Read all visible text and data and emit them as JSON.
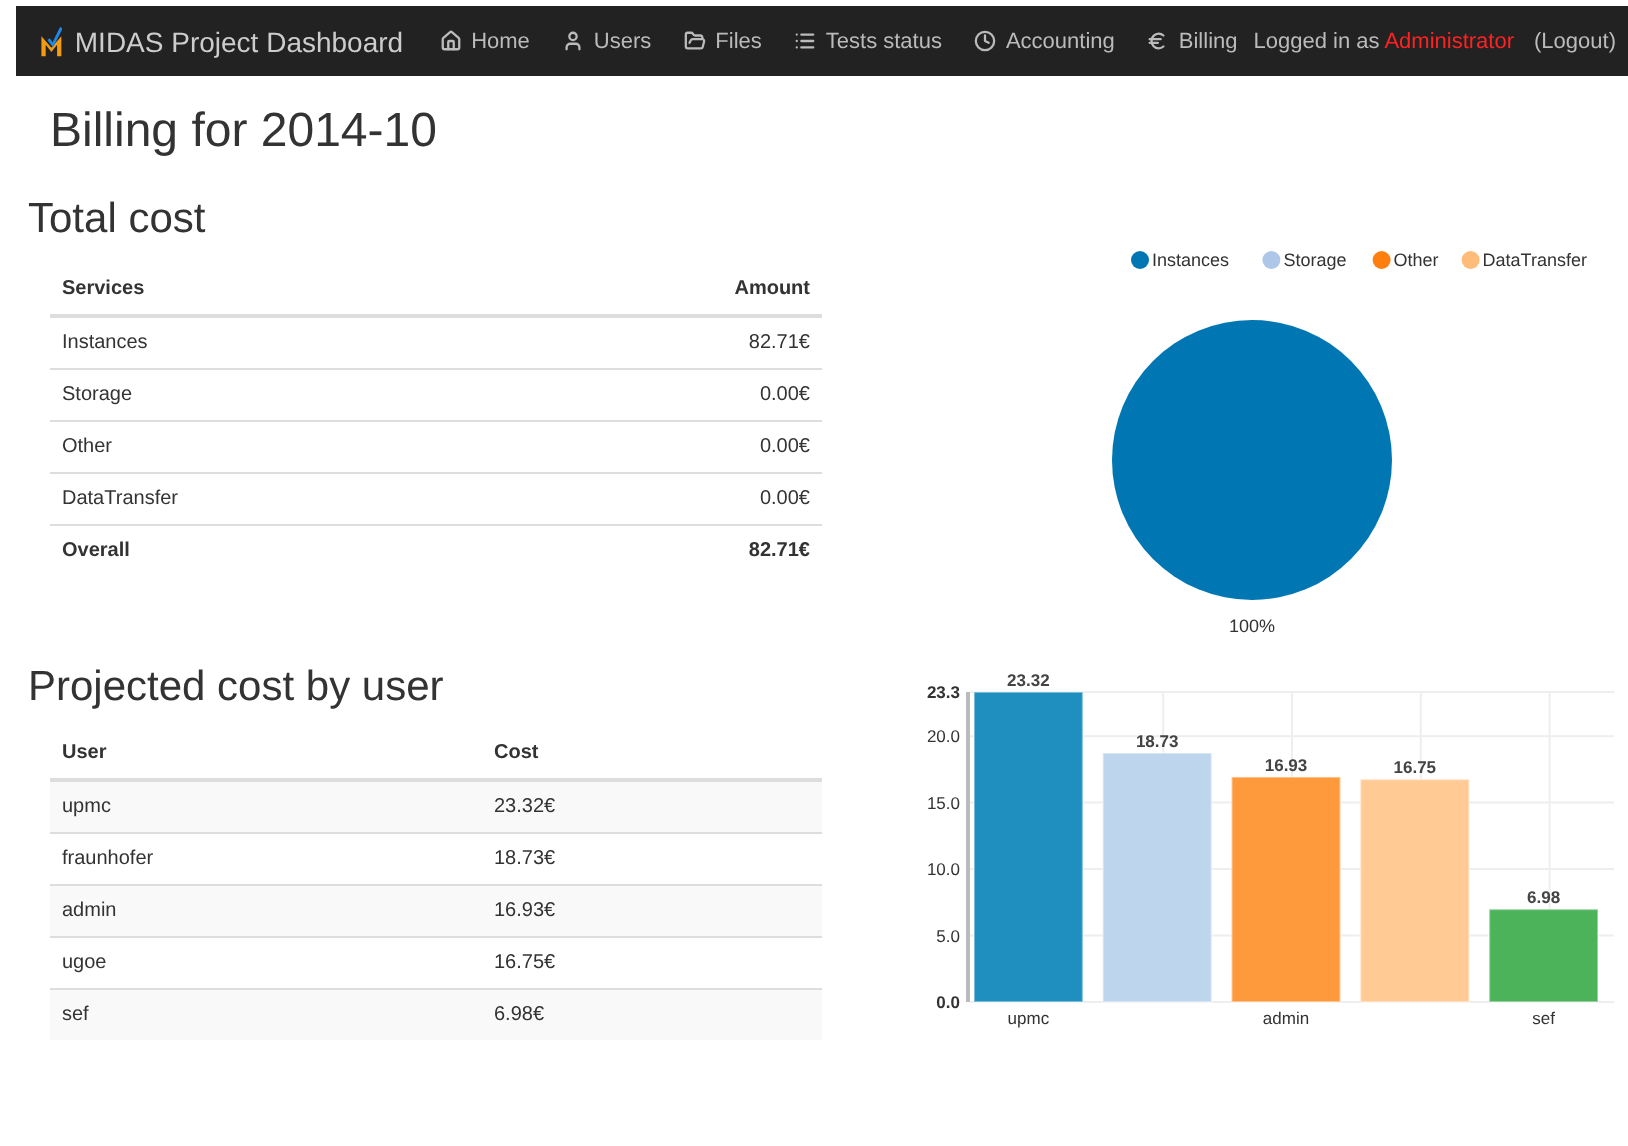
{
  "navbar": {
    "brand": "MIDAS Project Dashboard",
    "items": [
      {
        "label": "Home",
        "selected": false
      },
      {
        "label": "Users",
        "selected": false
      },
      {
        "label": "Files",
        "selected": false
      },
      {
        "label": "Tests status",
        "selected": false
      },
      {
        "label": "Accounting",
        "selected": false
      },
      {
        "label": "Billing",
        "selected": false
      }
    ],
    "login_prefix": "Logged in as",
    "user": "Administrator",
    "logout": "(Logout)"
  },
  "title": "Billing for 2014-10",
  "total_cost": {
    "heading": "Total cost",
    "columns": [
      "Services",
      "Amount"
    ],
    "rows": [
      {
        "cells": [
          "Instances",
          "82.71€"
        ],
        "bold": false
      },
      {
        "cells": [
          "Storage",
          "0.00€"
        ],
        "bold": false
      },
      {
        "cells": [
          "Other",
          "0.00€"
        ],
        "bold": false
      },
      {
        "cells": [
          "DataTransfer",
          "0.00€"
        ],
        "bold": false
      },
      {
        "cells": [
          "Overall",
          "82.71€"
        ],
        "bold": true
      }
    ],
    "chart_data": {
      "type": "pie",
      "categories": [
        "Instances",
        "Storage",
        "Other",
        "DataTransfer"
      ],
      "series": [
        {
          "values": [
            100,
            0,
            0,
            0
          ]
        }
      ],
      "colors": [
        "#0077b3",
        "#aec7e8",
        "#ff7f0e",
        "#ffbb78"
      ],
      "value_labels": [
        "100%",
        null,
        null,
        null
      ]
    }
  },
  "projected_cost": {
    "heading": "Projected cost by user",
    "columns": [
      "User",
      "Cost"
    ],
    "rows": [
      {
        "cells": [
          "upmc",
          "23.32€"
        ]
      },
      {
        "cells": [
          "fraunhofer",
          "18.73€"
        ]
      },
      {
        "cells": [
          "admin",
          "16.93€"
        ]
      },
      {
        "cells": [
          "ugoe",
          "16.75€"
        ]
      },
      {
        "cells": [
          "sef",
          "6.98€"
        ]
      }
    ],
    "chart_data": {
      "type": "bar",
      "categories": [
        "upmc",
        null,
        "admin",
        null,
        "sef"
      ],
      "series": [
        {
          "values": [
            23.32,
            18.73,
            16.93,
            16.75,
            6.98
          ]
        }
      ],
      "colors": [
        "#1f8fc0",
        "#bdd6ee",
        "#ff9a3c",
        "#ffca94",
        "#4db35a"
      ],
      "ylim": [
        0,
        23.32
      ],
      "grid": true,
      "yticks": [
        {
          "value": 0,
          "label": "0.0"
        },
        {
          "value": 5,
          "label": "5.0"
        },
        {
          "value": 10,
          "label": "10.0"
        },
        {
          "value": 15,
          "label": "15.0"
        },
        {
          "value": 20,
          "label": "20.0"
        },
        {
          "value": 23.32,
          "label": "23.3"
        }
      ],
      "data_labels": true
    }
  }
}
